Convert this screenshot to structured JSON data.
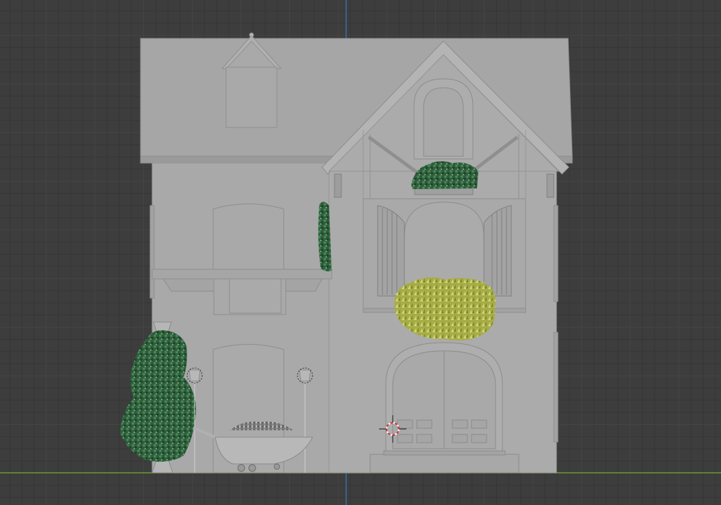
{
  "viewport": {
    "view": "front-orthographic",
    "grid": true,
    "colors": {
      "background": "#3d3d3d",
      "grid": "#474747",
      "z_axis": "#3b6ea8",
      "x_axis": "#6a9b2a",
      "model": "#a7a7a7",
      "cursor_red": "#d0303a"
    }
  },
  "scene": {
    "objects": [
      {
        "name": "house",
        "icon": "house-icon"
      },
      {
        "name": "ivy-plant"
      },
      {
        "name": "flower-box-plant"
      },
      {
        "name": "yellow-bush"
      },
      {
        "name": "cypress-tree"
      },
      {
        "name": "wheelbarrow"
      },
      {
        "name": "lamp-left"
      },
      {
        "name": "lamp-right"
      }
    ],
    "cursor_icon": "3d-cursor-icon"
  }
}
